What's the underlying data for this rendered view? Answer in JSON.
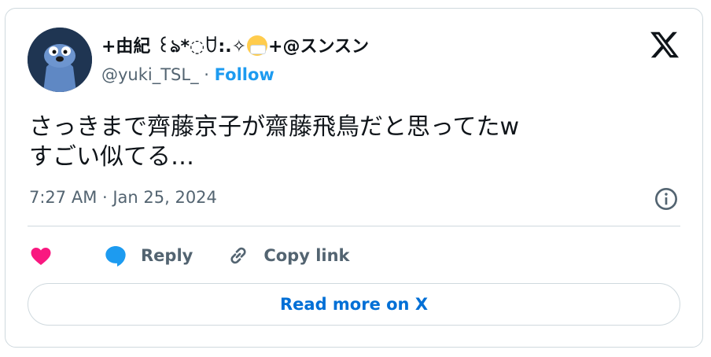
{
  "author": {
    "display_name": "+由紀 ꒰ঌ*◌ꇴ:.✧",
    "display_name_suffix": "+@スンスン",
    "handle": "@yuki_TSL_",
    "separator": "·",
    "follow_label": "Follow"
  },
  "tweet": {
    "lines": [
      "さっきまで齊藤京子が齋藤飛鳥だと思ってたw",
      "すごい似てる…"
    ],
    "timestamp": "7:27 AM · Jan 25, 2024"
  },
  "actions": {
    "reply_label": "Reply",
    "copy_link_label": "Copy link"
  },
  "read_more_label": "Read more on X",
  "colors": {
    "like": "#f91880",
    "reply": "#1d9bf0",
    "follow": "#1d9bf0",
    "read_more": "#006fd6",
    "muted": "#536471"
  },
  "icons": [
    "x-logo-icon",
    "info-icon",
    "heart-icon",
    "reply-bubble-icon",
    "link-icon",
    "mask-emoji-icon"
  ]
}
